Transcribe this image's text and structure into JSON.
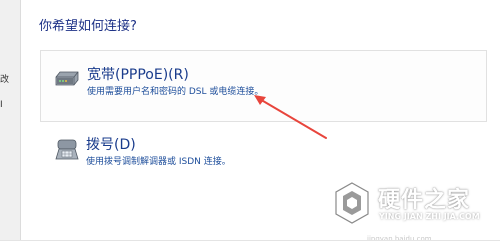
{
  "dialog": {
    "heading": "你希望如何连接?",
    "left_panel_glyphs": [
      "改",
      "I"
    ]
  },
  "options": [
    {
      "title": "宽带(PPPoE)(R)",
      "description": "使用需要用户名和密码的 DSL 或电缆连接。",
      "icon": "broadband-modem-icon",
      "selected": true
    },
    {
      "title": "拨号(D)",
      "description": "使用拨号调制解调器或 ISDN 连接。",
      "icon": "dialup-phone-icon",
      "selected": false
    }
  ],
  "annotation": {
    "arrow_color": "#e8453c"
  },
  "watermark": {
    "title": "硬件之家",
    "subtitle": "YING JIAN ZHI JIA.COM",
    "url": "jingyan.baidu.com"
  },
  "colors": {
    "heading": "#1e3287",
    "option_title": "#1a3c8c",
    "option_desc": "#1e4e9b"
  }
}
